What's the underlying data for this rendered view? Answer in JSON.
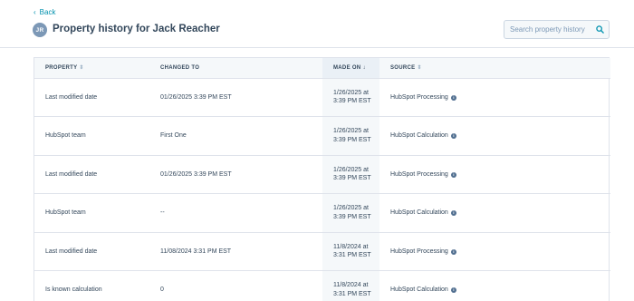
{
  "nav": {
    "back_label": "Back"
  },
  "header": {
    "avatar_initials": "JR",
    "title": "Property history for Jack Reacher"
  },
  "search": {
    "placeholder": "Search property history"
  },
  "table": {
    "columns": {
      "property": "PROPERTY",
      "changed_to": "CHANGED TO",
      "made_on": "MADE ON",
      "source": "SOURCE"
    },
    "rows": [
      {
        "property": "Last modified date",
        "changed_to": "01/26/2025 3:39 PM EST",
        "made_on": "1/26/2025 at 3:39 PM EST",
        "source": "HubSpot Processing"
      },
      {
        "property": "HubSpot team",
        "changed_to": "First One",
        "made_on": "1/26/2025 at 3:39 PM EST",
        "source": "HubSpot Calculation"
      },
      {
        "property": "Last modified date",
        "changed_to": "01/26/2025 3:39 PM EST",
        "made_on": "1/26/2025 at 3:39 PM EST",
        "source": "HubSpot Processing"
      },
      {
        "property": "HubSpot team",
        "changed_to": "--",
        "made_on": "1/26/2025 at 3:39 PM EST",
        "source": "HubSpot Calculation"
      },
      {
        "property": "Last modified date",
        "changed_to": "11/08/2024 3:31 PM EST",
        "made_on": "11/8/2024 at 3:31 PM EST",
        "source": "HubSpot Processing"
      },
      {
        "property": "Is known calculation",
        "changed_to": "0",
        "made_on": "11/8/2024 at 3:31 PM EST",
        "source": "HubSpot Calculation"
      }
    ]
  },
  "colors": {
    "accent": "#0091ae",
    "text": "#33475b",
    "avatar_bg": "#7c98b6",
    "border": "#dfe3eb"
  },
  "icons": {
    "back": "chevron-left-icon",
    "search": "search-icon",
    "sort": "sort-icon",
    "info": "info-icon"
  }
}
